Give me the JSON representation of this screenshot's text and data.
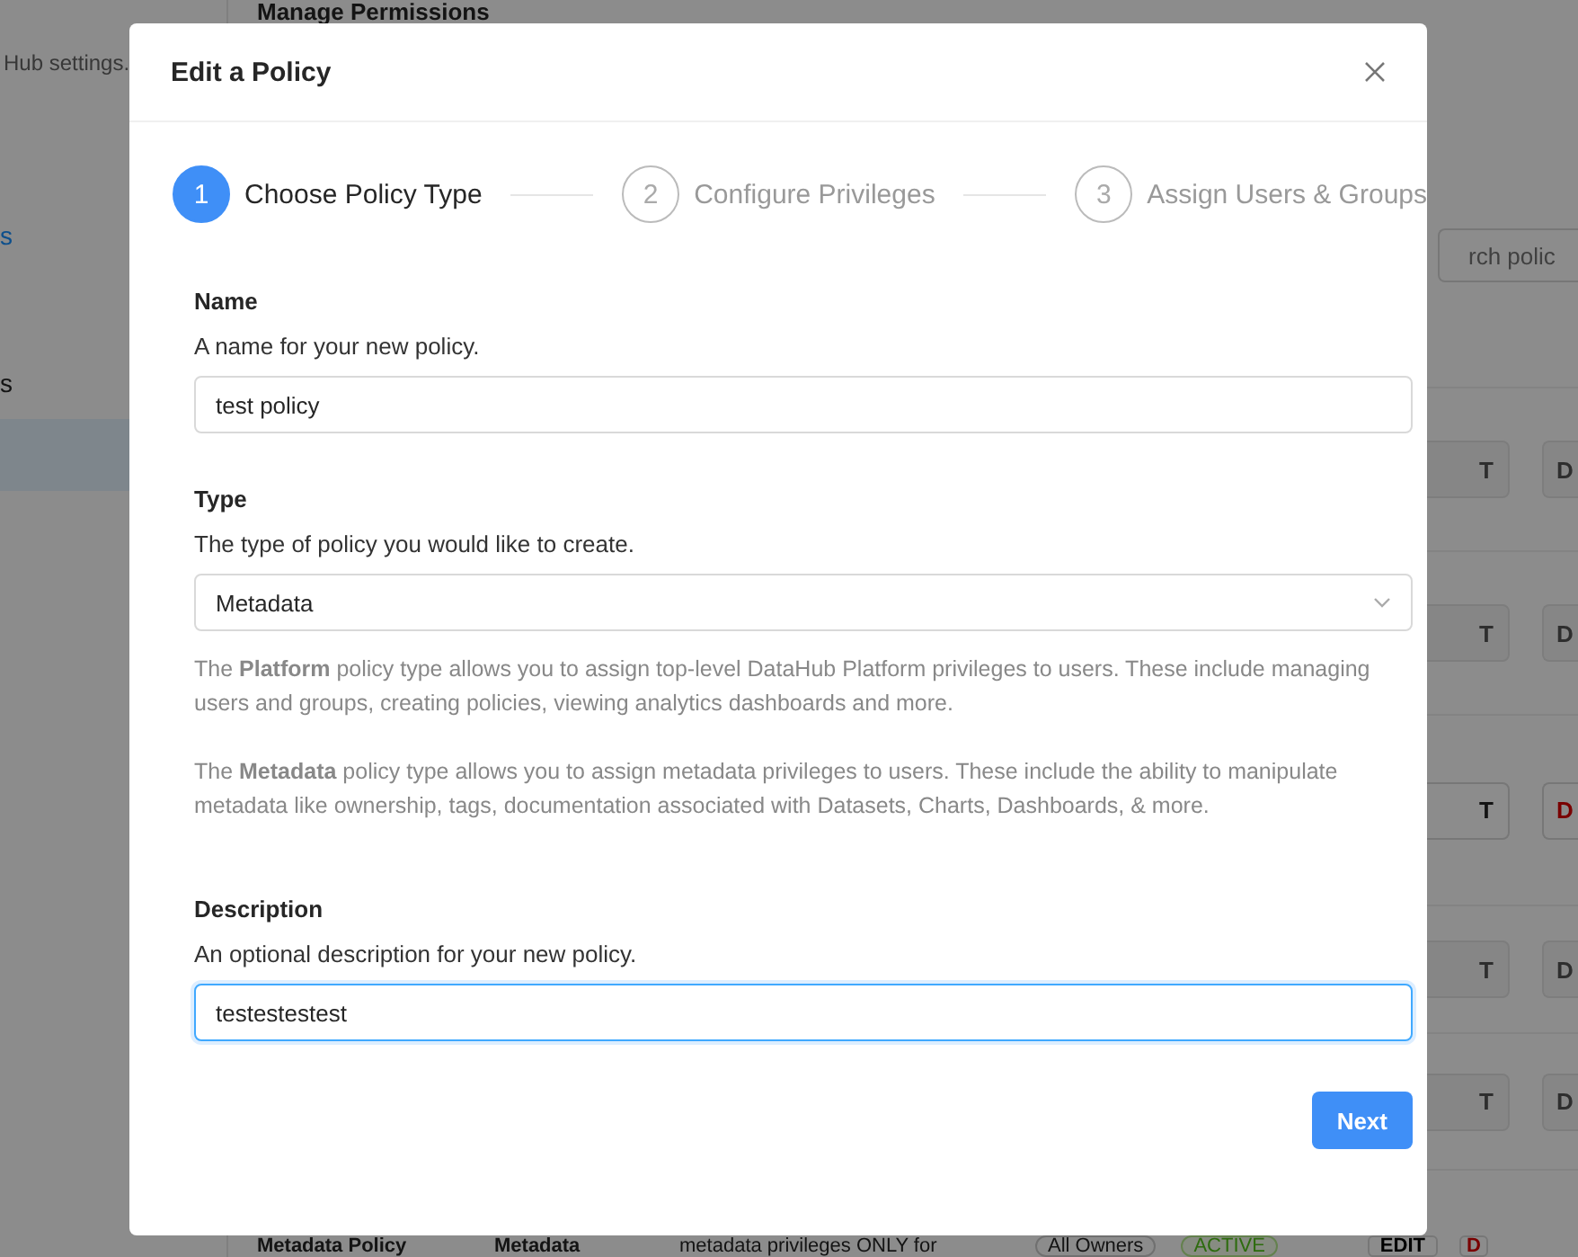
{
  "background_page": {
    "title": "Manage Permissions",
    "sidebar": {
      "description": "Hub settings.",
      "items": [
        {
          "label": "s",
          "kind": "link",
          "selected": false
        },
        {
          "label": "s",
          "kind": "text",
          "selected": false
        },
        {
          "kind": "blank",
          "selected": true
        }
      ]
    },
    "search": {
      "placeholder": "rch polic"
    },
    "rows": [
      {
        "edit": "T",
        "delete": "D",
        "disabled": true
      },
      {
        "edit": "T",
        "delete": "D",
        "disabled": true
      },
      {
        "edit": "T",
        "delete": "D",
        "disabled": false
      },
      {
        "edit": "T",
        "delete": "D",
        "disabled": true
      },
      {
        "edit": "T",
        "delete": "D",
        "disabled": true
      }
    ],
    "last_row": {
      "name": "Metadata Policy",
      "type": "Metadata",
      "description": "metadata privileges ONLY for",
      "owners": "All Owners",
      "status": "ACTIVE",
      "edit": "EDIT",
      "delete": "D"
    }
  },
  "modal": {
    "title": "Edit a Policy",
    "steps": [
      {
        "number": "1",
        "label": "Choose Policy Type",
        "selected": true
      },
      {
        "number": "2",
        "label": "Configure Privileges",
        "selected": false
      },
      {
        "number": "3",
        "label": "Assign Users & Groups",
        "selected": false
      }
    ],
    "name": {
      "label": "Name",
      "help": "A name for your new policy.",
      "value": "test policy",
      "focused": false
    },
    "type": {
      "label": "Type",
      "help": "The type of policy you would like to create.",
      "value": "Metadata"
    },
    "type_notes": [
      "The **Platform** policy type allows you to assign top-level DataHub Platform privileges to users. These include managing users and groups, creating policies, viewing analytics dashboards and more.",
      "The **Metadata** policy type allows you to assign metadata privileges to users. These include the ability to manipulate metadata like ownership, tags, documentation associated with Datasets, Charts, Dashboards, & more."
    ],
    "description": {
      "label": "Description",
      "help": "An optional description for your new policy.",
      "value": "testestestest",
      "focused": true
    },
    "next_button": "Next"
  }
}
